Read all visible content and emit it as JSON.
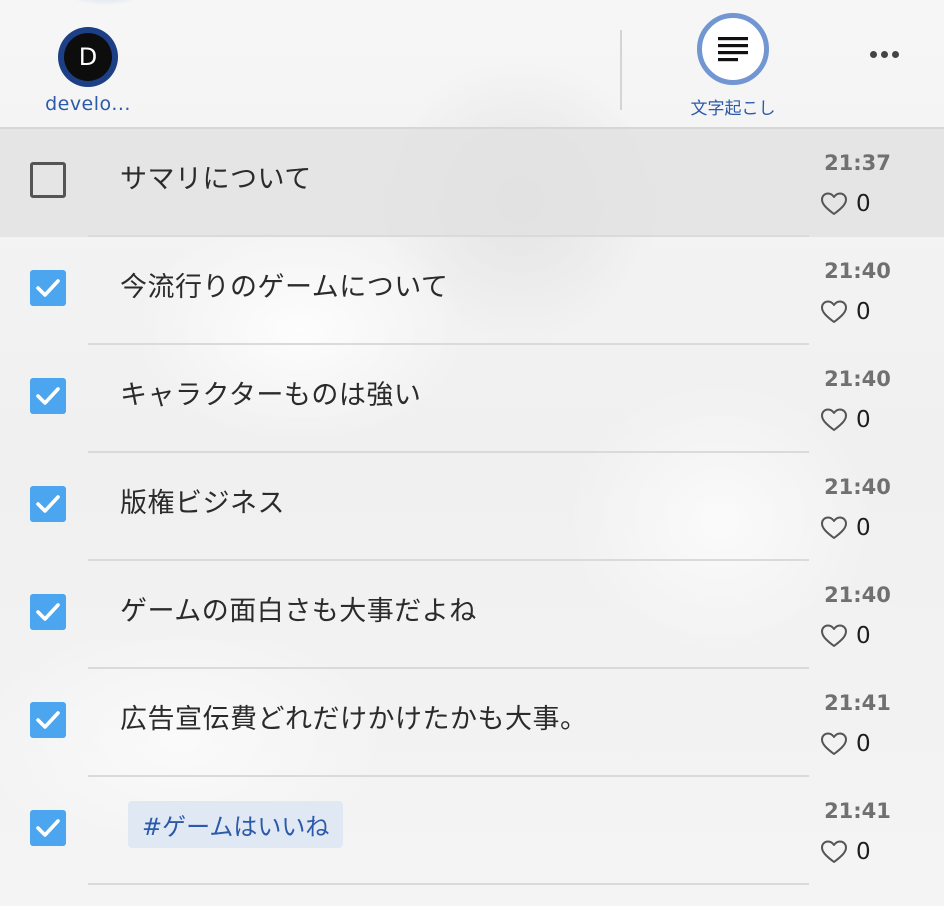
{
  "header": {
    "user": {
      "initial": "D",
      "name": "develo..."
    },
    "transcribe_label": "文字起こし"
  },
  "items": [
    {
      "text": "サマリについて",
      "time": "21:37",
      "likes": "0",
      "checked": false,
      "is_tag": false,
      "active": true
    },
    {
      "text": "今流行りのゲームについて",
      "time": "21:40",
      "likes": "0",
      "checked": true,
      "is_tag": false,
      "active": false
    },
    {
      "text": "キャラクターものは強い",
      "time": "21:40",
      "likes": "0",
      "checked": true,
      "is_tag": false,
      "active": false
    },
    {
      "text": "版権ビジネス",
      "time": "21:40",
      "likes": "0",
      "checked": true,
      "is_tag": false,
      "active": false
    },
    {
      "text": "ゲームの面白さも大事だよね",
      "time": "21:40",
      "likes": "0",
      "checked": true,
      "is_tag": false,
      "active": false
    },
    {
      "text": "広告宣伝費どれだけかけたかも大事。",
      "time": "21:41",
      "likes": "0",
      "checked": true,
      "is_tag": false,
      "active": false
    },
    {
      "text": "#ゲームはいいね",
      "time": "21:41",
      "likes": "0",
      "checked": true,
      "is_tag": true,
      "active": false
    }
  ],
  "colors": {
    "accent": "#2a5aa9",
    "checkbox": "#4ba5ef",
    "ring": "#7196d2"
  },
  "icons": {
    "transcribe": "lines-text-icon",
    "more": "more-horizontal-icon",
    "like": "heart-outline-icon",
    "check": "checkmark-icon"
  }
}
